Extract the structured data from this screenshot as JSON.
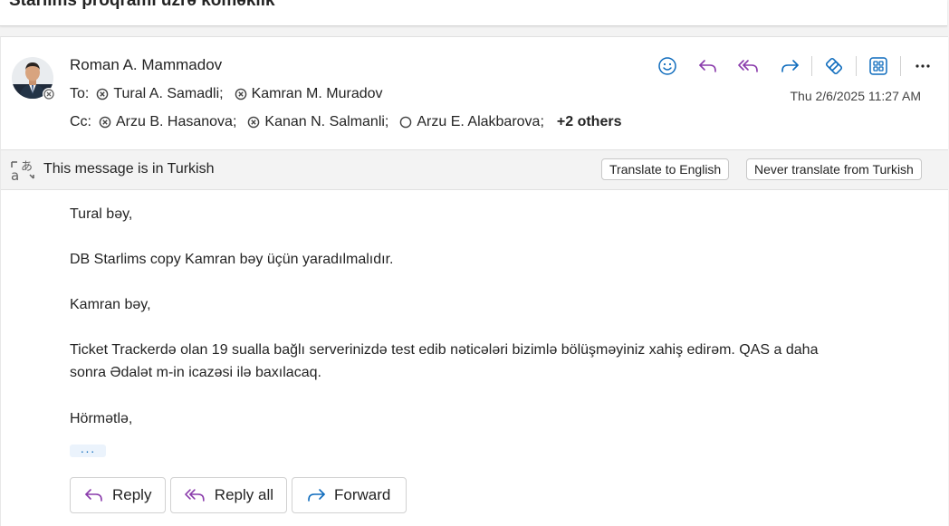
{
  "subject": "Starlims proqramı üzrə köməklik",
  "message": {
    "sender": "Roman A. Mammadov",
    "to_label": "To:",
    "to": [
      "Tural A. Samadli;",
      "Kamran M. Muradov"
    ],
    "cc_label": "Cc:",
    "cc": [
      "Arzu B. Hasanova;",
      "Kanan N. Salmanli;",
      "Arzu E. Alakbarova;"
    ],
    "cc_more": "+2 others",
    "timestamp": "Thu 2/6/2025 11:27 AM"
  },
  "translate": {
    "notice": "This message is in Turkish",
    "translate_button": "Translate to English",
    "never_button": "Never translate from Turkish"
  },
  "body": {
    "lines": [
      "Tural bəy,",
      "DB Starlims copy Kamran bəy üçün yaradılmalıdır.",
      "Kamran bəy,",
      "Ticket Trackerdə olan 19 sualla bağlı serverinizdə test edib nəticələri bizimlə bölüşməyiniz xahiş edirəm. QAS a daha",
      "sonra Ədalət m-in icazəsi ilə baxılacaq.",
      "Hörmətlə,"
    ],
    "ellipsis": "···"
  },
  "reply_bar": {
    "reply": "Reply",
    "reply_all": "Reply all",
    "forward": "Forward"
  },
  "colors": {
    "accent_blue": "#0f6cbd",
    "reply_purple": "#8a3bab"
  }
}
